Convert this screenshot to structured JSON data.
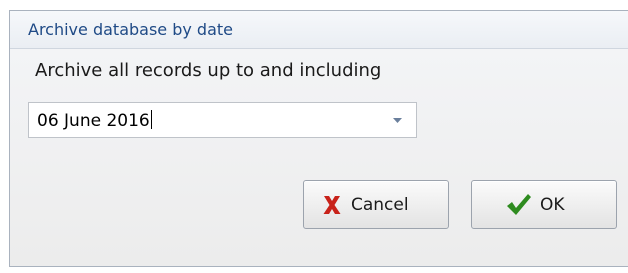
{
  "dialog": {
    "title": "Archive database by date",
    "prompt": "Archive all records up to and including",
    "date_field": {
      "value": "06 June 2016",
      "dropdown_icon": "chevron-down-icon"
    },
    "buttons": {
      "cancel": {
        "label": "Cancel",
        "icon": "red-x-icon",
        "icon_color": "#c8221a"
      },
      "ok": {
        "label": "OK",
        "icon": "green-checkmark-icon",
        "icon_color": "#2e8b1f"
      }
    }
  },
  "colors": {
    "title_text": "#1f4a86",
    "dialog_background": "#f1f1f1"
  }
}
